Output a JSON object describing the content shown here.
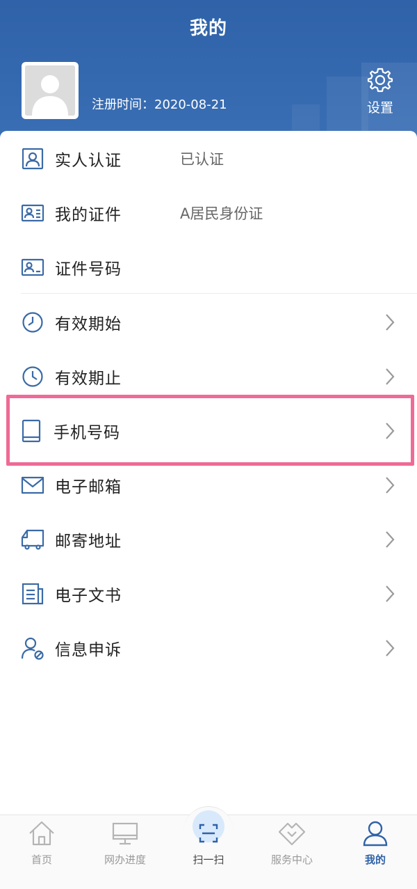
{
  "header": {
    "title": "我的",
    "register_time": "注册时间：2020-08-21",
    "settings_label": "设置"
  },
  "menu": [
    {
      "label": "实人认证",
      "value": "已认证",
      "icon": "id-person-icon",
      "chevron": false
    },
    {
      "label": "我的证件",
      "value": "A居民身份证",
      "icon": "id-card-icon",
      "chevron": false
    },
    {
      "label": "证件号码",
      "value": "",
      "icon": "id-number-icon",
      "chevron": false
    },
    {
      "label": "有效期始",
      "value": "",
      "icon": "clock-icon",
      "chevron": true
    },
    {
      "label": "有效期止",
      "value": "",
      "icon": "clock-icon",
      "chevron": true
    },
    {
      "label": "手机号码",
      "value": "",
      "icon": "tablet-icon",
      "chevron": true,
      "highlighted": true
    },
    {
      "label": "电子邮箱",
      "value": "",
      "icon": "mail-icon",
      "chevron": true
    },
    {
      "label": "邮寄地址",
      "value": "",
      "icon": "truck-icon",
      "chevron": true
    },
    {
      "label": "电子文书",
      "value": "",
      "icon": "document-icon",
      "chevron": true
    },
    {
      "label": "信息申诉",
      "value": "",
      "icon": "user-block-icon",
      "chevron": true
    }
  ],
  "tabbar": [
    {
      "label": "首页",
      "icon": "home-icon",
      "active": false
    },
    {
      "label": "网办进度",
      "icon": "monitor-icon",
      "active": false
    },
    {
      "label": "扫一扫",
      "icon": "scan-icon",
      "active": false
    },
    {
      "label": "服务中心",
      "icon": "handshake-icon",
      "active": false
    },
    {
      "label": "我的",
      "icon": "user-icon",
      "active": true
    }
  ],
  "colors": {
    "primary": "#2f62a8",
    "icon": "#3a6aa6",
    "highlight": "#ef6a96",
    "tab_inactive": "#999999"
  }
}
